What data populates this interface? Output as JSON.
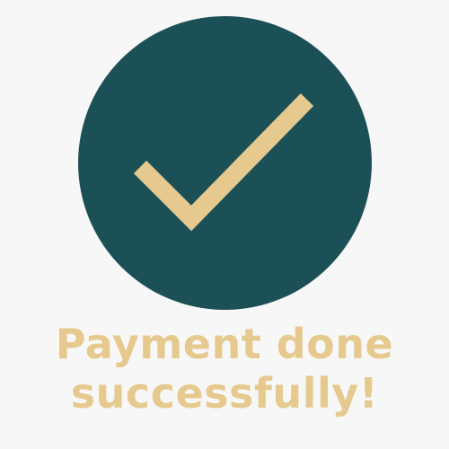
{
  "colors": {
    "background": "#f8f7f7",
    "badge": "#1b5057",
    "accent": "#e5c98e"
  },
  "badge": {
    "icon": "checkmark-icon"
  },
  "message": {
    "line1": "Payment done",
    "line2": "successfully!"
  }
}
